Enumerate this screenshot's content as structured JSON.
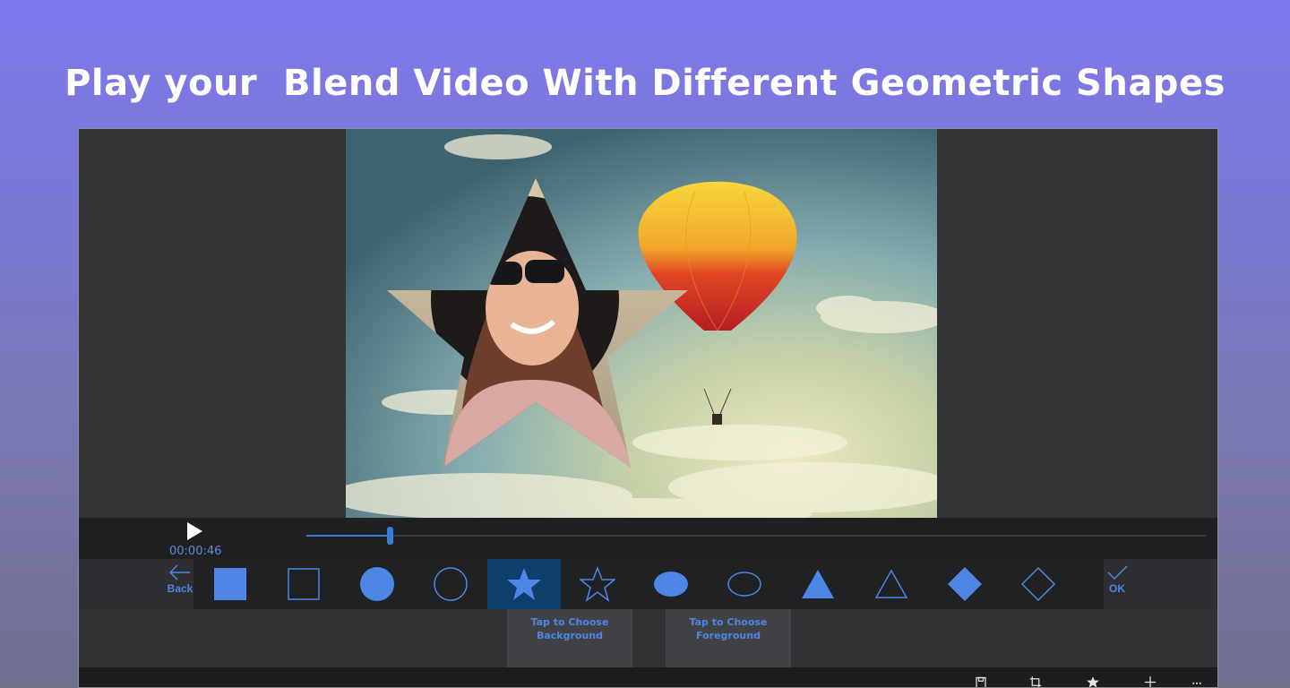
{
  "headline": "Play your  Blend Video With Different Geometric Shapes",
  "player": {
    "time": "00:00:46",
    "progress": 0.093
  },
  "toolbar": {
    "back_label": "Back",
    "ok_label": "OK",
    "shapes": [
      {
        "name": "square-filled-icon",
        "active": false
      },
      {
        "name": "square-outline-icon",
        "active": false
      },
      {
        "name": "circle-filled-icon",
        "active": false
      },
      {
        "name": "circle-outline-icon",
        "active": false
      },
      {
        "name": "star-filled-icon",
        "active": true
      },
      {
        "name": "star-outline-icon",
        "active": false
      },
      {
        "name": "ellipse-filled-icon",
        "active": false
      },
      {
        "name": "ellipse-outline-icon",
        "active": false
      },
      {
        "name": "triangle-filled-icon",
        "active": false
      },
      {
        "name": "triangle-outline-icon",
        "active": false
      },
      {
        "name": "diamond-filled-icon",
        "active": false
      },
      {
        "name": "diamond-outline-icon",
        "active": false
      }
    ]
  },
  "choose": {
    "background_line1": "Tap to Choose",
    "background_line2": "Background",
    "foreground_line1": "Tap to Choose",
    "foreground_line2": "Foreground"
  },
  "appbar_icons": [
    "save-icon",
    "crop-icon",
    "star-icon",
    "add-icon",
    "more-icon"
  ],
  "colors": {
    "accent": "#4d86e6",
    "active_tile": "#0e3f6a",
    "seek": "#3a7bd5"
  }
}
